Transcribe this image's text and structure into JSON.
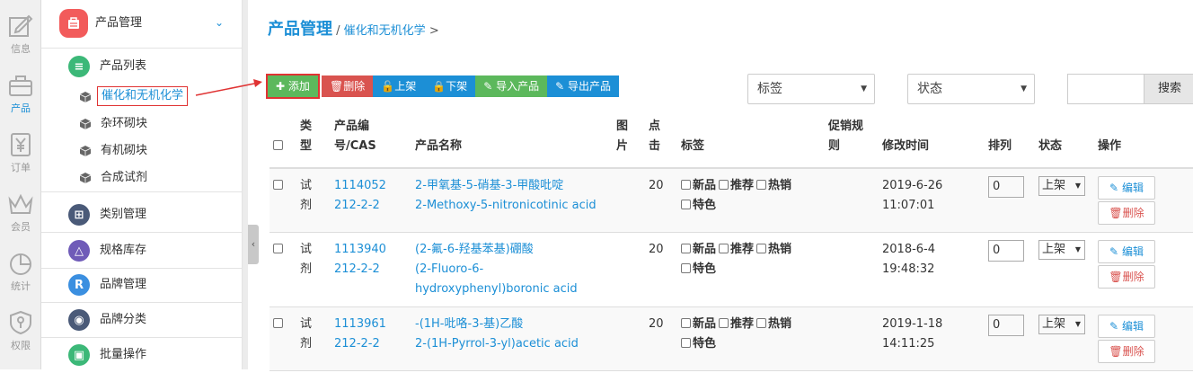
{
  "rail": [
    {
      "label": "信息",
      "icon": "edit-icon"
    },
    {
      "label": "产品",
      "icon": "briefcase-icon",
      "active": true
    },
    {
      "label": "订单",
      "icon": "yen-icon"
    },
    {
      "label": "会员",
      "icon": "crown-icon"
    },
    {
      "label": "统计",
      "icon": "pie-chart-icon"
    },
    {
      "label": "权限",
      "icon": "key-shield-icon"
    }
  ],
  "sidebar": {
    "header": "产品管理",
    "list_title": "产品列表",
    "subitems": [
      "催化和无机化学",
      "杂环砌块",
      "有机砌块",
      "合成试剂"
    ],
    "groups": [
      "类别管理",
      "规格库存",
      "品牌管理",
      "品牌分类",
      "批量操作"
    ]
  },
  "breadcrumb": {
    "title": "产品管理",
    "sep": "/",
    "current": "催化和无机化学",
    "arrow": ">"
  },
  "toolbar": {
    "add": "添加",
    "delete": "删除",
    "on": "上架",
    "off": "下架",
    "import": "导入产品",
    "export": "导出产品"
  },
  "filters": {
    "tag": "标签",
    "status": "状态",
    "search": "搜索"
  },
  "columns": {
    "type1": "类",
    "type2": "型",
    "code1": "产品编",
    "code2": "号/CAS",
    "name": "产品名称",
    "img1": "图",
    "img2": "片",
    "click1": "点",
    "click2": "击",
    "tags": "标签",
    "promo1": "促销规",
    "promo2": "则",
    "time": "修改时间",
    "sort": "排列",
    "status": "状态",
    "ops": "操作"
  },
  "tag_labels": {
    "new": "新品",
    "rec": "推荐",
    "hot": "热销",
    "feat": "特色"
  },
  "ops": {
    "edit": "编辑",
    "del": "删除"
  },
  "rows": [
    {
      "type1": "试",
      "type2": "剂",
      "code": "1114052",
      "cas": "212-2-2",
      "name_lines": [
        "2-甲氧基-5-硝基-3-甲酸吡啶",
        "2-Methoxy-5-nitronicotinic acid"
      ],
      "clicks": "20",
      "date": "2019-6-26",
      "time": "11:07:01",
      "sort": "0",
      "status": "上架"
    },
    {
      "type1": "试",
      "type2": "剂",
      "code": "1113940",
      "cas": "212-2-2",
      "name_lines": [
        "(2-氟-6-羟基苯基)硼酸",
        "(2-Fluoro-6-",
        "hydroxyphenyl)boronic acid"
      ],
      "clicks": "20",
      "date": "2018-6-4",
      "time": "19:48:32",
      "sort": "0",
      "status": "上架"
    },
    {
      "type1": "试",
      "type2": "剂",
      "code": "1113961",
      "cas": "212-2-2",
      "name_lines": [
        "-(1H-吡咯-3-基)乙酸",
        "2-(1H-Pyrrol-3-yl)acetic acid"
      ],
      "clicks": "20",
      "date": "2019-1-18",
      "time": "14:11:25",
      "sort": "0",
      "status": "上架"
    }
  ]
}
